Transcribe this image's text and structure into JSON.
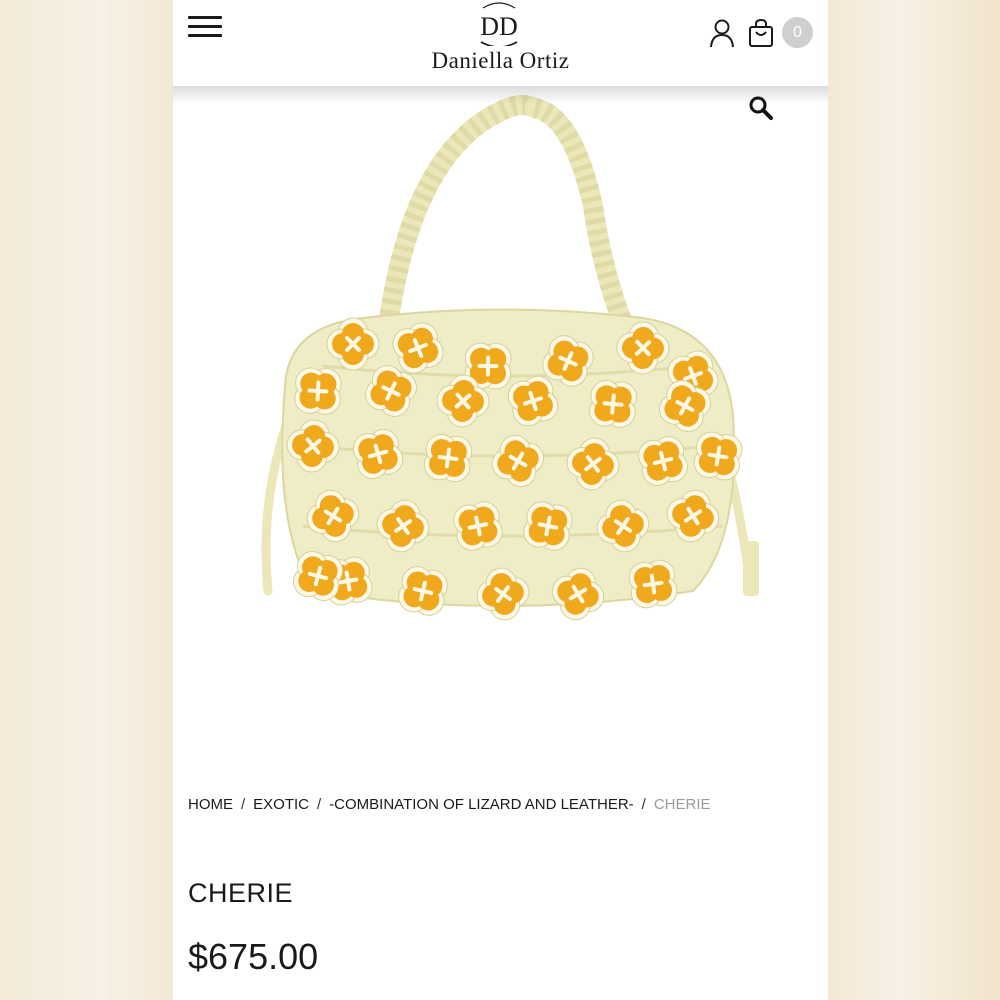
{
  "header": {
    "brand_name": "Daniella Ortiz",
    "logo_initials": "DD",
    "cart_count": "0",
    "icons": [
      "menu-icon",
      "user-icon",
      "cart-icon",
      "zoom-icon"
    ]
  },
  "product": {
    "image_alt": "Cream handbag with yellow flower appliqués",
    "title": "CHERIE",
    "price": "$675.00"
  },
  "breadcrumb": {
    "items": [
      "HOME",
      "EXOTIC",
      "-COMBINATION OF LIZARD AND LEATHER-"
    ],
    "separator": "/",
    "current": "CHERIE"
  },
  "colors": {
    "bag_cream": "#efedc6",
    "flower_yellow": "#f0a81c",
    "flower_edge": "#fbf8e6",
    "badge_gray": "#cfcfcf"
  }
}
